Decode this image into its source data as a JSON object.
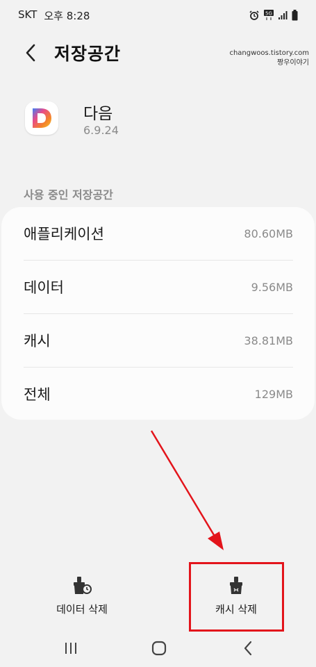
{
  "status_bar": {
    "carrier": "SKT",
    "time": "오후 8:28",
    "icons": [
      "alarm-icon",
      "5g-icon",
      "signal-icon",
      "battery-icon"
    ]
  },
  "header": {
    "title": "저장공간",
    "back_icon": "chevron-left-icon"
  },
  "watermark": {
    "line1": "changwoos.tistory.com",
    "line2": "짱우이야기"
  },
  "app": {
    "name": "다음",
    "version": "6.9.24",
    "icon_letter": "D"
  },
  "storage": {
    "section_label": "사용 중인 저장공간",
    "rows": [
      {
        "label": "애플리케이션",
        "value": "80.60MB"
      },
      {
        "label": "데이터",
        "value": "9.56MB"
      },
      {
        "label": "캐시",
        "value": "38.81MB"
      },
      {
        "label": "전체",
        "value": "129MB"
      }
    ]
  },
  "actions": {
    "clear_data_label": "데이터 삭제",
    "clear_cache_label": "캐시 삭제"
  },
  "colors": {
    "annotation": "#e3141b",
    "background": "#f2f2f2",
    "card": "#fcfcfc"
  },
  "nav_bar": {
    "icons": [
      "recent-apps-icon",
      "home-icon",
      "back-icon"
    ]
  }
}
